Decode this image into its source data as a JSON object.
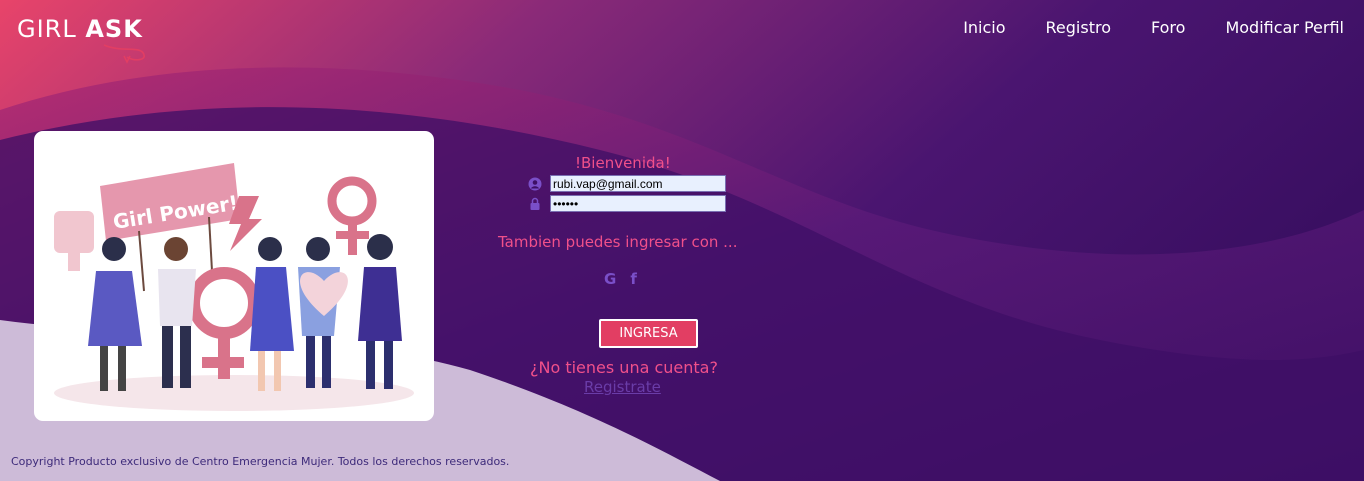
{
  "brand": {
    "logo_light": "GIRL ",
    "logo_bold": "ASK"
  },
  "nav": {
    "items": [
      {
        "label": "Inicio",
        "name": "nav-inicio"
      },
      {
        "label": "Registro",
        "name": "nav-registro"
      },
      {
        "label": "Foro",
        "name": "nav-foro"
      },
      {
        "label": "Modificar Perfil",
        "name": "nav-modificar-perfil"
      }
    ]
  },
  "illustration": {
    "banner_text": "Girl Power!"
  },
  "login": {
    "welcome": "!Bienvenida!",
    "email_value": "rubi.vap@gmail.com",
    "password_value": "••••••",
    "also_text": "Tambien puedes ingresar con ...",
    "social_google": "G",
    "social_facebook": "f",
    "submit_label": "INGRESA",
    "no_account": "¿No tienes una cuenta?",
    "register_link": "Registrate"
  },
  "footer": {
    "copyright": "Copyright Producto exclusivo de Centro Emergencia Mujer. Todos los derechos reservados."
  },
  "colors": {
    "accent_pink": "#f0508a",
    "button": "#e23e63",
    "bg_purple": "#3d1065",
    "bg_light": "#cfbcd9"
  },
  "icons": [
    "user-icon",
    "lock-icon",
    "google-icon",
    "facebook-icon"
  ]
}
